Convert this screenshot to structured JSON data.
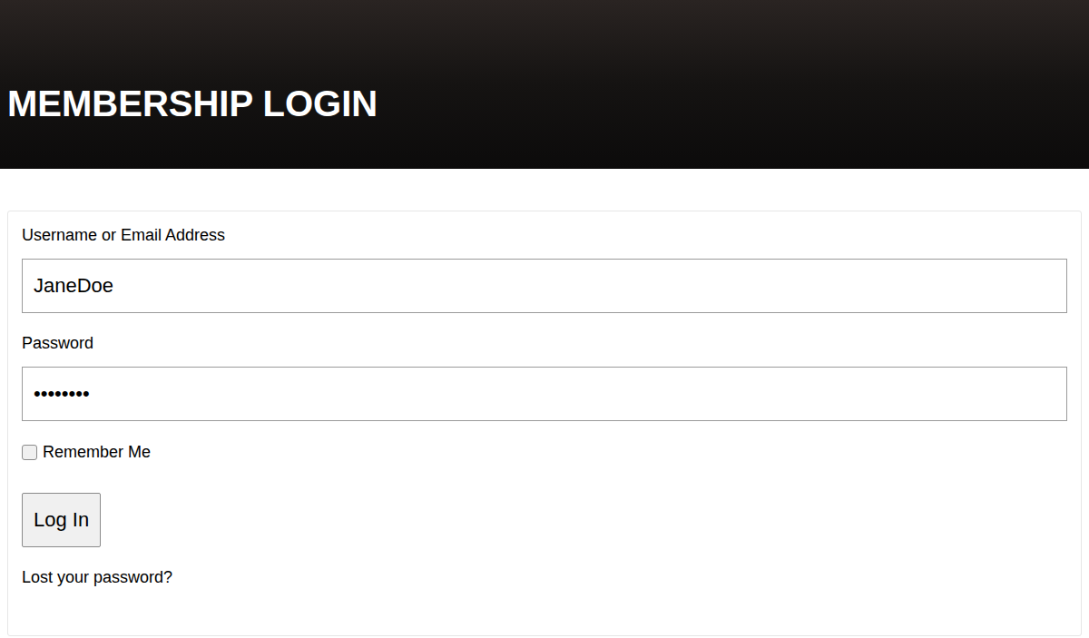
{
  "header": {
    "title": "MEMBERSHIP LOGIN"
  },
  "form": {
    "fields": [
      {
        "label": "Username or Email Address",
        "value": "JaneDoe"
      },
      {
        "label": "Password",
        "value": "••••••••"
      }
    ],
    "remember": {
      "label": "Remember Me",
      "checked": false
    },
    "button": "Log In",
    "link": "Lost your password?"
  }
}
